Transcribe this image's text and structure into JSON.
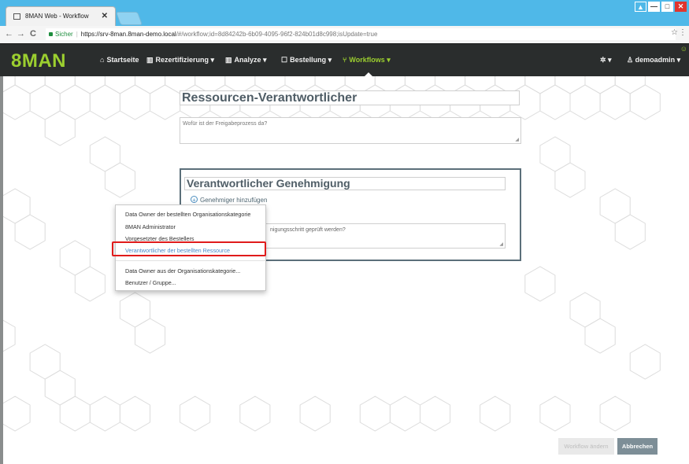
{
  "browser": {
    "tab_title": "8MAN Web - Workflow",
    "tab_close": "✕",
    "back": "←",
    "forward": "→",
    "reload": "C",
    "secure_label": "Sicher",
    "url_host": "https://srv-8man.8man-demo.local",
    "url_path": "/#/workflow;id=8d84242b-6b09-4095-96f2-824b01d8c998;isUpdate=true",
    "star": "☆",
    "menu": "⋮",
    "window_buttons": {
      "user": "▲",
      "min": "—",
      "max": "□",
      "close": "✕"
    }
  },
  "nav": {
    "brand": "8MAN",
    "items": [
      {
        "icon": "⌂",
        "label": "Startseite"
      },
      {
        "icon": "▥",
        "label": "Rezertifizierung ▾"
      },
      {
        "icon": "▥",
        "label": "Analyze ▾"
      },
      {
        "icon": "☐",
        "label": "Bestellung ▾"
      },
      {
        "icon": "⑂",
        "label": "Workflows ▾"
      }
    ],
    "settings": "✲ ▾",
    "user": "♙ demoadmin ▾",
    "notification": "☺"
  },
  "workflow": {
    "title": "Ressourcen-Verantwortlicher",
    "description_placeholder": "Wofür ist der Freigabeprozess da?"
  },
  "step": {
    "title": "Verantwortlicher Genehmigung",
    "add_approver": "Genehmiger hinzufügen",
    "add_icon": "+",
    "description_partial": "nigungsschritt geprüft werden?"
  },
  "dropdown": {
    "items": [
      "Data Owner der bestellten Organisationskategorie",
      "8MAN Administrator",
      "Vorgesetzter des Bestellers",
      "Verantwortlicher der bestellten Ressource",
      "Data Owner aus der Organisationskategorie...",
      "Benutzer / Gruppe..."
    ]
  },
  "footer": {
    "change_button": "Workflow ändern",
    "cancel_button": "Abbrechen"
  }
}
